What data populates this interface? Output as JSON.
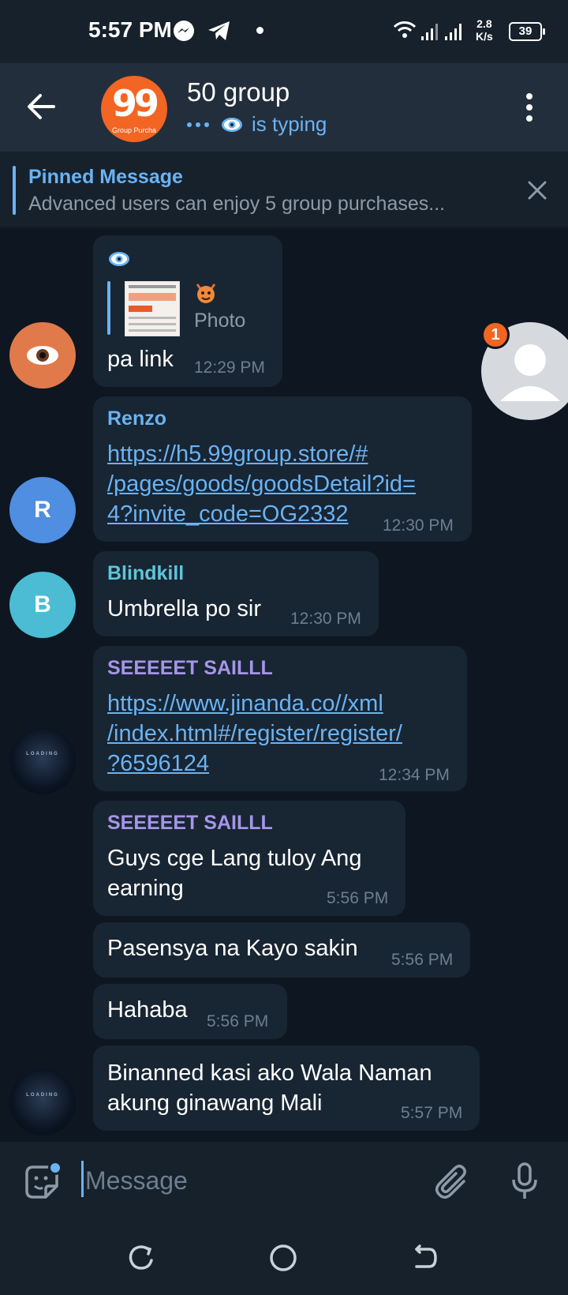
{
  "status_bar": {
    "time": "5:57 PM",
    "speed_value": "2.8",
    "speed_unit": "K/s",
    "battery": "39"
  },
  "header": {
    "title": "50 group",
    "typing_status": "is typing",
    "avatar_text": "99",
    "avatar_caption": "Group Purcha"
  },
  "pinned": {
    "title": "Pinned Message",
    "text": "Advanced users can enjoy 5 group purchases..."
  },
  "messages": [
    {
      "sender": "",
      "reply_label": "Photo",
      "text": "pa link",
      "time": "12:29 PM"
    },
    {
      "sender": "Renzo",
      "avatar_letter": "R",
      "link_lines": [
        "https://h5.99group.store/#",
        "/pages/goods/goodsDetail?id=",
        "4?invite_code=OG2332"
      ],
      "time": "12:30 PM"
    },
    {
      "sender": "Blindkill",
      "avatar_letter": "B",
      "text": "Umbrella po sir",
      "time": "12:30 PM"
    },
    {
      "sender": "SEEEEET SAILLL",
      "link_lines": [
        "https://www.jinanda.co//xml",
        "/index.html#/register/register/",
        "?6596124"
      ],
      "time": "12:34 PM"
    },
    {
      "sender": "SEEEEET SAILLL",
      "text_lines": [
        "Guys cge Lang tuloy Ang",
        "earning"
      ],
      "time": "5:56 PM"
    },
    {
      "text": "Pasensya na Kayo sakin",
      "time": "5:56 PM"
    },
    {
      "text": "Hahaba",
      "time": "5:56 PM"
    },
    {
      "text_lines": [
        "Binanned kasi ako Wala Naman",
        "akung ginawang Mali"
      ],
      "time": "5:57 PM"
    }
  ],
  "space_avatar_text": "LOADING",
  "floating_badge": "1",
  "input": {
    "placeholder": "Message"
  },
  "colors": {
    "accent": "#6ab3f3",
    "bubble": "#182533",
    "chat_bg": "#0e1621",
    "header_bg": "#232e3c",
    "renzo_name": "#6ab3f3",
    "blindkill_name": "#5fc5d8",
    "seeeeet_name": "#a695e7"
  }
}
